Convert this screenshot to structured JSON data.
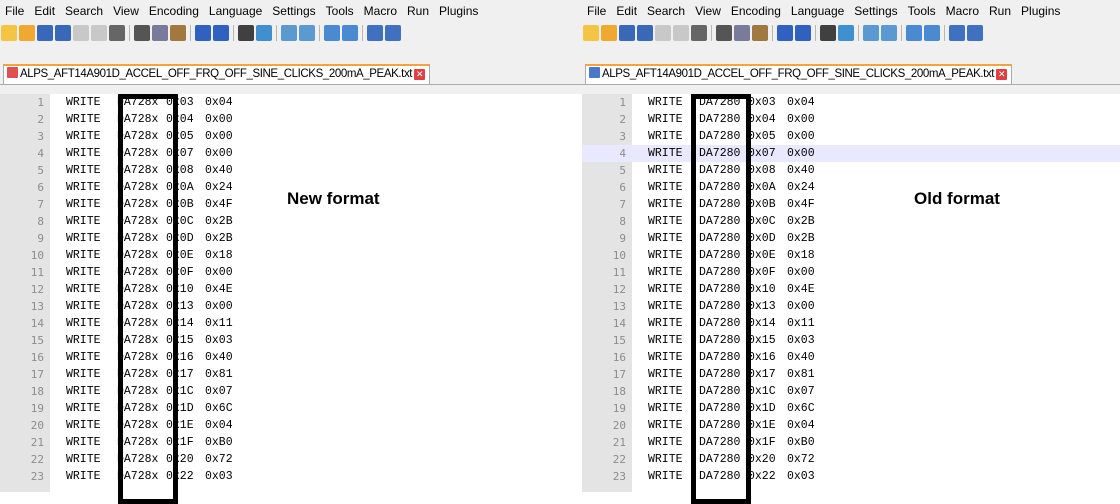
{
  "menu_left": [
    "File",
    "Edit",
    "Search",
    "View",
    "Encoding",
    "Language",
    "Settings",
    "Tools",
    "Macro",
    "Run",
    "Plugins"
  ],
  "menu_right": [
    "File",
    "Edit",
    "Search",
    "View",
    "Encoding",
    "Language",
    "Settings",
    "Tools",
    "Macro",
    "Run",
    "Plugins"
  ],
  "toolbar_icons": [
    "new-file-icon",
    "open-file-icon",
    "save-icon",
    "save-all-icon",
    "close-icon",
    "close-all-icon",
    "print-icon",
    "|",
    "cut-icon",
    "copy-icon",
    "paste-icon",
    "|",
    "undo-icon",
    "redo-icon",
    "|",
    "find-icon",
    "replace-icon",
    "|",
    "zoom-in-icon",
    "zoom-out-icon",
    "|",
    "sync-vertical-icon",
    "sync-horizontal-icon",
    "|",
    "word-wrap-icon",
    "show-all-chars-icon"
  ],
  "left": {
    "tab_title": "ALPS_AFT14A901D_ACCEL_OFF_FRQ_OFF_SINE_CLICKS_200mA_PEAK.txt",
    "annotation": "New format",
    "lines": [
      {
        "n": "1",
        "cmd": "WRITE",
        "dev": "DA728x",
        "reg": "0x03",
        "val": "0x04"
      },
      {
        "n": "2",
        "cmd": "WRITE",
        "dev": "DA728x",
        "reg": "0x04",
        "val": "0x00"
      },
      {
        "n": "3",
        "cmd": "WRITE",
        "dev": "DA728x",
        "reg": "0x05",
        "val": "0x00"
      },
      {
        "n": "4",
        "cmd": "WRITE",
        "dev": "DA728x",
        "reg": "0x07",
        "val": "0x00"
      },
      {
        "n": "5",
        "cmd": "WRITE",
        "dev": "DA728x",
        "reg": "0x08",
        "val": "0x40"
      },
      {
        "n": "6",
        "cmd": "WRITE",
        "dev": "DA728x",
        "reg": "0x0A",
        "val": "0x24"
      },
      {
        "n": "7",
        "cmd": "WRITE",
        "dev": "DA728x",
        "reg": "0x0B",
        "val": "0x4F"
      },
      {
        "n": "8",
        "cmd": "WRITE",
        "dev": "DA728x",
        "reg": "0x0C",
        "val": "0x2B"
      },
      {
        "n": "9",
        "cmd": "WRITE",
        "dev": "DA728x",
        "reg": "0x0D",
        "val": "0x2B"
      },
      {
        "n": "10",
        "cmd": "WRITE",
        "dev": "DA728x",
        "reg": "0x0E",
        "val": "0x18"
      },
      {
        "n": "11",
        "cmd": "WRITE",
        "dev": "DA728x",
        "reg": "0x0F",
        "val": "0x00"
      },
      {
        "n": "12",
        "cmd": "WRITE",
        "dev": "DA728x",
        "reg": "0x10",
        "val": "0x4E"
      },
      {
        "n": "13",
        "cmd": "WRITE",
        "dev": "DA728x",
        "reg": "0x13",
        "val": "0x00"
      },
      {
        "n": "14",
        "cmd": "WRITE",
        "dev": "DA728x",
        "reg": "0x14",
        "val": "0x11"
      },
      {
        "n": "15",
        "cmd": "WRITE",
        "dev": "DA728x",
        "reg": "0x15",
        "val": "0x03"
      },
      {
        "n": "16",
        "cmd": "WRITE",
        "dev": "DA728x",
        "reg": "0x16",
        "val": "0x40"
      },
      {
        "n": "17",
        "cmd": "WRITE",
        "dev": "DA728x",
        "reg": "0x17",
        "val": "0x81"
      },
      {
        "n": "18",
        "cmd": "WRITE",
        "dev": "DA728x",
        "reg": "0x1C",
        "val": "0x07"
      },
      {
        "n": "19",
        "cmd": "WRITE",
        "dev": "DA728x",
        "reg": "0x1D",
        "val": "0x6C"
      },
      {
        "n": "20",
        "cmd": "WRITE",
        "dev": "DA728x",
        "reg": "0x1E",
        "val": "0x04"
      },
      {
        "n": "21",
        "cmd": "WRITE",
        "dev": "DA728x",
        "reg": "0x1F",
        "val": "0xB0"
      },
      {
        "n": "22",
        "cmd": "WRITE",
        "dev": "DA728x",
        "reg": "0x20",
        "val": "0x72"
      },
      {
        "n": "23",
        "cmd": "WRITE",
        "dev": "DA728x",
        "reg": "0x22",
        "val": "0x03"
      }
    ]
  },
  "right": {
    "tab_title": "ALPS_AFT14A901D_ACCEL_OFF_FRQ_OFF_SINE_CLICKS_200mA_PEAK.txt",
    "annotation": "Old format",
    "lines": [
      {
        "n": "1",
        "cmd": "WRITE",
        "dev": "DA7280",
        "reg": "0x03",
        "val": "0x04"
      },
      {
        "n": "2",
        "cmd": "WRITE",
        "dev": "DA7280",
        "reg": "0x04",
        "val": "0x00"
      },
      {
        "n": "3",
        "cmd": "WRITE",
        "dev": "DA7280",
        "reg": "0x05",
        "val": "0x00"
      },
      {
        "n": "4",
        "cmd": "WRITE",
        "dev": "DA7280",
        "reg": "0x07",
        "val": "0x00"
      },
      {
        "n": "5",
        "cmd": "WRITE",
        "dev": "DA7280",
        "reg": "0x08",
        "val": "0x40"
      },
      {
        "n": "6",
        "cmd": "WRITE",
        "dev": "DA7280",
        "reg": "0x0A",
        "val": "0x24"
      },
      {
        "n": "7",
        "cmd": "WRITE",
        "dev": "DA7280",
        "reg": "0x0B",
        "val": "0x4F"
      },
      {
        "n": "8",
        "cmd": "WRITE",
        "dev": "DA7280",
        "reg": "0x0C",
        "val": "0x2B"
      },
      {
        "n": "9",
        "cmd": "WRITE",
        "dev": "DA7280",
        "reg": "0x0D",
        "val": "0x2B"
      },
      {
        "n": "10",
        "cmd": "WRITE",
        "dev": "DA7280",
        "reg": "0x0E",
        "val": "0x18"
      },
      {
        "n": "11",
        "cmd": "WRITE",
        "dev": "DA7280",
        "reg": "0x0F",
        "val": "0x00"
      },
      {
        "n": "12",
        "cmd": "WRITE",
        "dev": "DA7280",
        "reg": "0x10",
        "val": "0x4E"
      },
      {
        "n": "13",
        "cmd": "WRITE",
        "dev": "DA7280",
        "reg": "0x13",
        "val": "0x00"
      },
      {
        "n": "14",
        "cmd": "WRITE",
        "dev": "DA7280",
        "reg": "0x14",
        "val": "0x11"
      },
      {
        "n": "15",
        "cmd": "WRITE",
        "dev": "DA7280",
        "reg": "0x15",
        "val": "0x03"
      },
      {
        "n": "16",
        "cmd": "WRITE",
        "dev": "DA7280",
        "reg": "0x16",
        "val": "0x40"
      },
      {
        "n": "17",
        "cmd": "WRITE",
        "dev": "DA7280",
        "reg": "0x17",
        "val": "0x81"
      },
      {
        "n": "18",
        "cmd": "WRITE",
        "dev": "DA7280",
        "reg": "0x1C",
        "val": "0x07"
      },
      {
        "n": "19",
        "cmd": "WRITE",
        "dev": "DA7280",
        "reg": "0x1D",
        "val": "0x6C"
      },
      {
        "n": "20",
        "cmd": "WRITE",
        "dev": "DA7280",
        "reg": "0x1E",
        "val": "0x04"
      },
      {
        "n": "21",
        "cmd": "WRITE",
        "dev": "DA7280",
        "reg": "0x1F",
        "val": "0xB0"
      },
      {
        "n": "22",
        "cmd": "WRITE",
        "dev": "DA7280",
        "reg": "0x20",
        "val": "0x72"
      },
      {
        "n": "23",
        "cmd": "WRITE",
        "dev": "DA7280",
        "reg": "0x22",
        "val": "0x03"
      }
    ]
  },
  "colors": {
    "tab_accent": "#f7a23c",
    "save_icon_unsaved": "#e05050",
    "save_icon_saved": "#4a78c8",
    "current_line": "#e8e8ff",
    "highlight_box": "#000000"
  }
}
